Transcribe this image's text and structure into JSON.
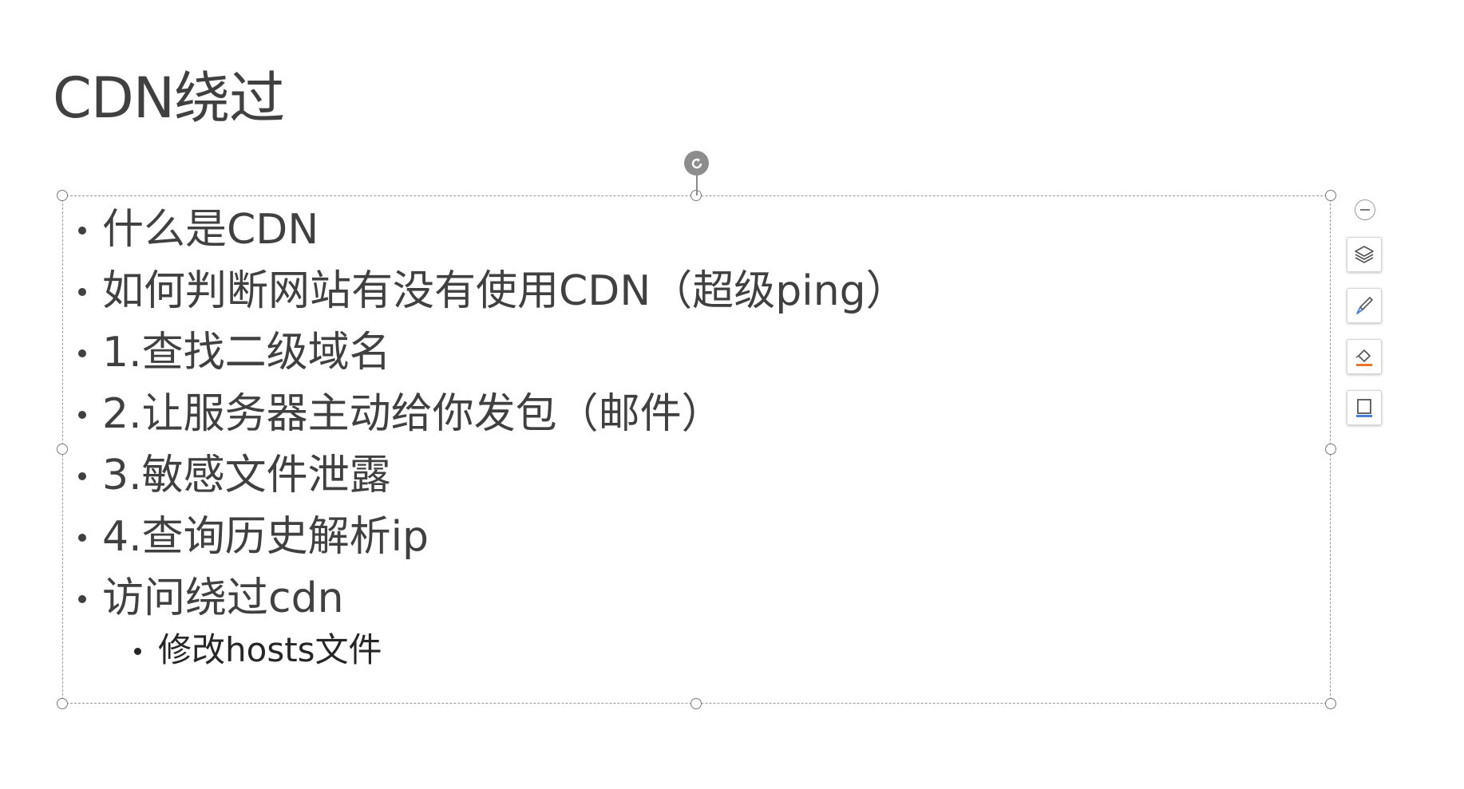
{
  "slide": {
    "title": "CDN绕过",
    "bullets": [
      "什么是CDN",
      "如何判断网站有没有使用CDN（超级ping）",
      "1.查找二级域名",
      "2.让服务器主动给你发包（邮件）",
      "3.敏感文件泄露",
      "4.查询历史解析ip",
      "访问绕过cdn"
    ],
    "sub_bullets": [
      "修改hosts文件"
    ]
  },
  "floating_toolbar": {
    "icons": [
      "collapse-icon",
      "layers-icon",
      "brush-icon",
      "fill-icon",
      "outline-icon"
    ],
    "accent_orange": "#e8742a",
    "accent_blue": "#4a7fd4"
  }
}
